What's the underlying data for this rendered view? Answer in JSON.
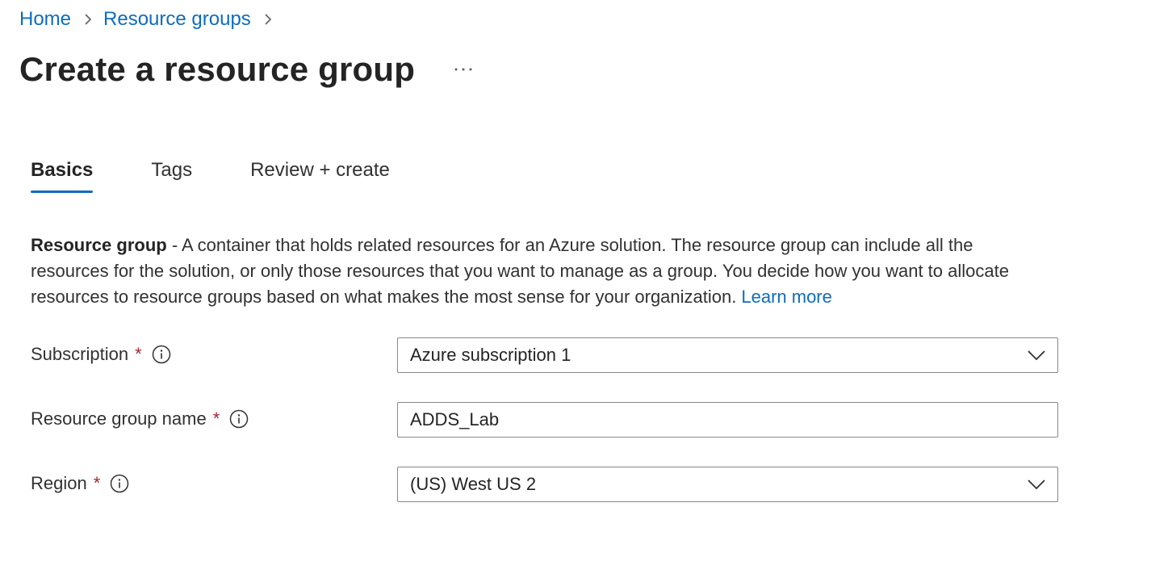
{
  "breadcrumb": {
    "items": [
      {
        "label": "Home"
      },
      {
        "label": "Resource groups"
      }
    ]
  },
  "page": {
    "title": "Create a resource group"
  },
  "tabs": [
    {
      "label": "Basics",
      "active": true
    },
    {
      "label": "Tags",
      "active": false
    },
    {
      "label": "Review + create",
      "active": false
    }
  ],
  "description": {
    "bold": "Resource group",
    "text": " - A container that holds related resources for an Azure solution. The resource group can include all the resources for the solution, or only those resources that you want to manage as a group. You decide how you want to allocate resources to resource groups based on what makes the most sense for your organization.",
    "learn_more": "Learn more"
  },
  "form": {
    "subscription": {
      "label": "Subscription",
      "required_mark": "*",
      "value": "Azure subscription 1"
    },
    "resource_group_name": {
      "label": "Resource group name",
      "required_mark": "*",
      "value": "ADDS_Lab"
    },
    "region": {
      "label": "Region",
      "required_mark": "*",
      "value": "(US) West US 2"
    }
  },
  "icons": {
    "breadcrumb_separator": "chevron-right-icon",
    "more": "more-horizontal-icon",
    "info": "info-icon",
    "dropdown": "chevron-down-icon"
  },
  "colors": {
    "link": "#0f6cbd",
    "required": "#a4262c",
    "text": "#323130",
    "border": "#8a8886"
  }
}
